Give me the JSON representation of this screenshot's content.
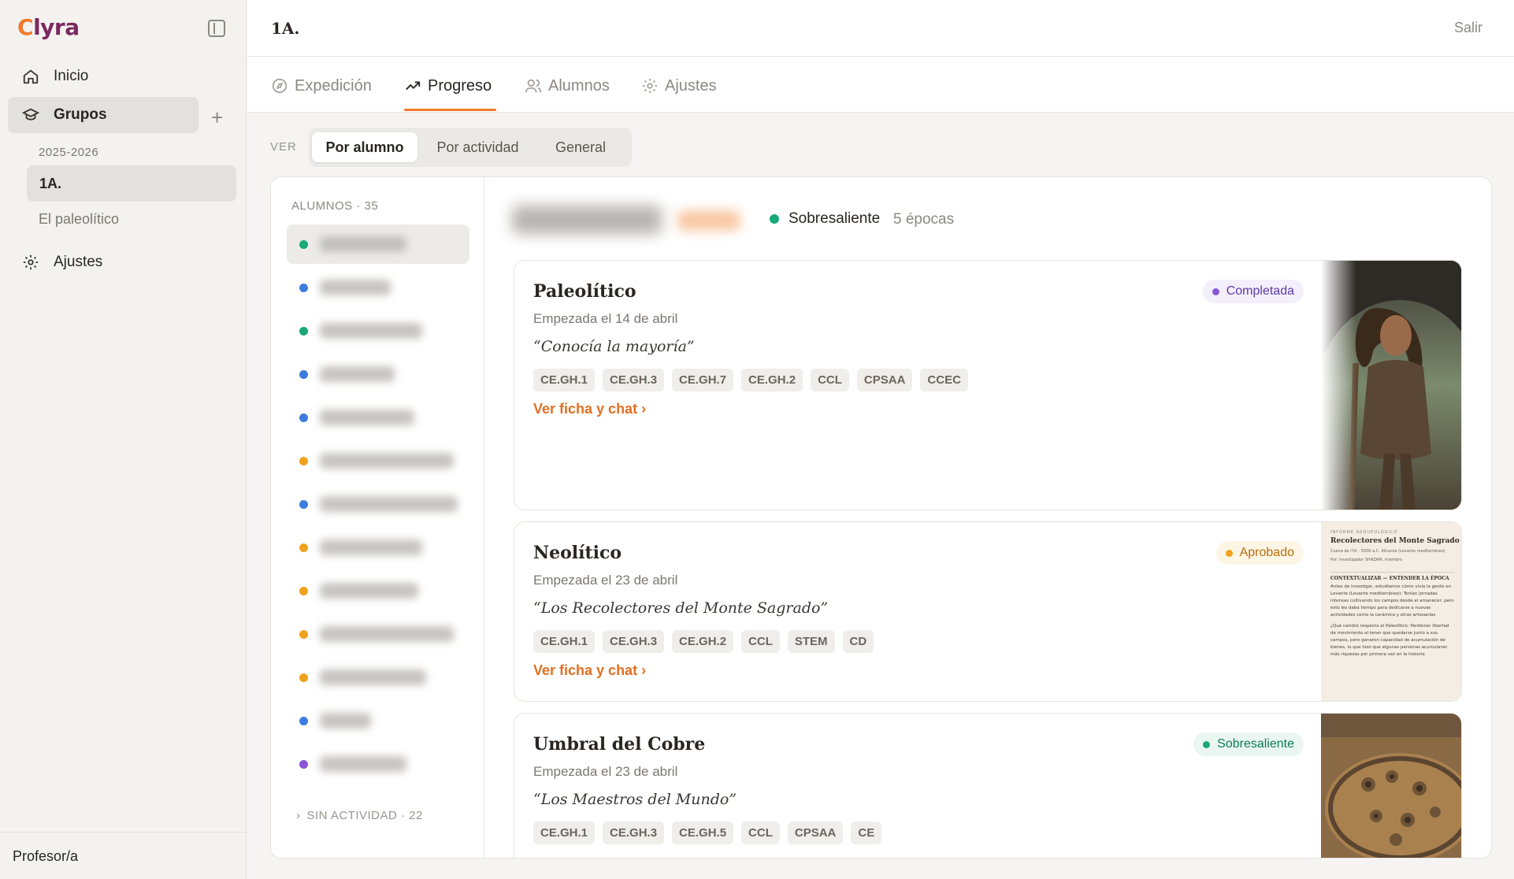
{
  "app": {
    "logo_a": "C",
    "logo_b": "lyra"
  },
  "sidebar": {
    "items": [
      {
        "label": "Inicio",
        "icon": "home-icon"
      },
      {
        "label": "Grupos",
        "icon": "graduation-cap-icon"
      },
      {
        "label": "Ajustes",
        "icon": "gear-icon"
      }
    ],
    "year": "2025-2026",
    "group": "1A.",
    "expedition": "El paleolítico",
    "footer": "Profesor/a"
  },
  "header": {
    "title": "1A.",
    "logout": "Salir"
  },
  "tabs": [
    {
      "label": "Expedición",
      "icon": "compass-icon"
    },
    {
      "label": "Progreso",
      "icon": "trending-up-icon"
    },
    {
      "label": "Alumnos",
      "icon": "users-icon"
    },
    {
      "label": "Ajustes",
      "icon": "gear-icon"
    }
  ],
  "view": {
    "label": "VER",
    "options": [
      "Por alumno",
      "Por actividad",
      "General"
    ],
    "selected": "Por alumno"
  },
  "students": {
    "header": "ALUMNOS · 35",
    "dot_colors": [
      "#19a877",
      "#3d7be0",
      "#19a877",
      "#3d7be0",
      "#3d7be0",
      "#f0a21e",
      "#3d7be0",
      "#f0a21e",
      "#f0a21e",
      "#f0a21e",
      "#f0a21e",
      "#3d7be0",
      "#8a55d6"
    ],
    "inactive": "SIN ACTIVIDAD · 22"
  },
  "detail": {
    "status": "Sobresaliente",
    "epochs": "5 épocas",
    "cards": [
      {
        "title": "Paleolítico",
        "date": "Empezada el 14 de abril",
        "quote": "“Conocía la mayoría”",
        "chips": [
          "CE.GH.1",
          "CE.GH.3",
          "CE.GH.7",
          "CE.GH.2",
          "CCL",
          "CPSAA",
          "CCEC"
        ],
        "link": "Ver ficha y chat ›",
        "badge": "Completada",
        "badge_color": "#8a55d6",
        "badge_bg": "#f3effb"
      },
      {
        "title": "Neolítico",
        "date": "Empezada el 23 de abril",
        "quote": "“Los Recolectores del Monte Sagrado”",
        "chips": [
          "CE.GH.1",
          "CE.GH.3",
          "CE.GH.2",
          "CCL",
          "STEM",
          "CD"
        ],
        "link": "Ver ficha y chat ›",
        "badge": "Aprobado",
        "badge_color": "#f0a21e",
        "badge_bg": "#fdf5e6"
      },
      {
        "title": "Umbral del Cobre",
        "date": "Empezada el 23 de abril",
        "quote": "“Los Maestros del Mundo”",
        "chips": [
          "CE.GH.1",
          "CE.GH.3",
          "CE.GH.5",
          "CCL",
          "CPSAA",
          "CE"
        ],
        "badge": "Sobresaliente",
        "badge_color": "#19a877",
        "badge_bg": "#eaf7f1"
      }
    ],
    "doc_thumb": {
      "kicker": "INFORME ARQUEOLÓGICO",
      "title": "Recolectores del Monte Sagrado",
      "meta": "Cueva de l'Or · 5500 a.C.    Alicante (Levante mediterráneo)",
      "byline": "Por: Investigador SHAZAM, miembro",
      "section": "CONTEXTUALIZAR — ENTENDER LA ÉPOCA",
      "p1": "Antes de investigar, estudiamos cómo vivía la gente en Levante (Levante mediterráneo): Tenían jornadas intensas cultivando los campos desde el amanecer, pero esto les daba tiempo para dedicarse a nuevas actividades como la cerámica y otras artesanías",
      "p2": "¿Qué cambió respecto al Paleolítico: Perdieron libertad de movimiento al tener que quedarse junto a sus campos, pero ganaron capacidad de acumulación de bienes, lo que hizo que algunas personas acumularan más riquezas por primera vez en la historia"
    }
  }
}
